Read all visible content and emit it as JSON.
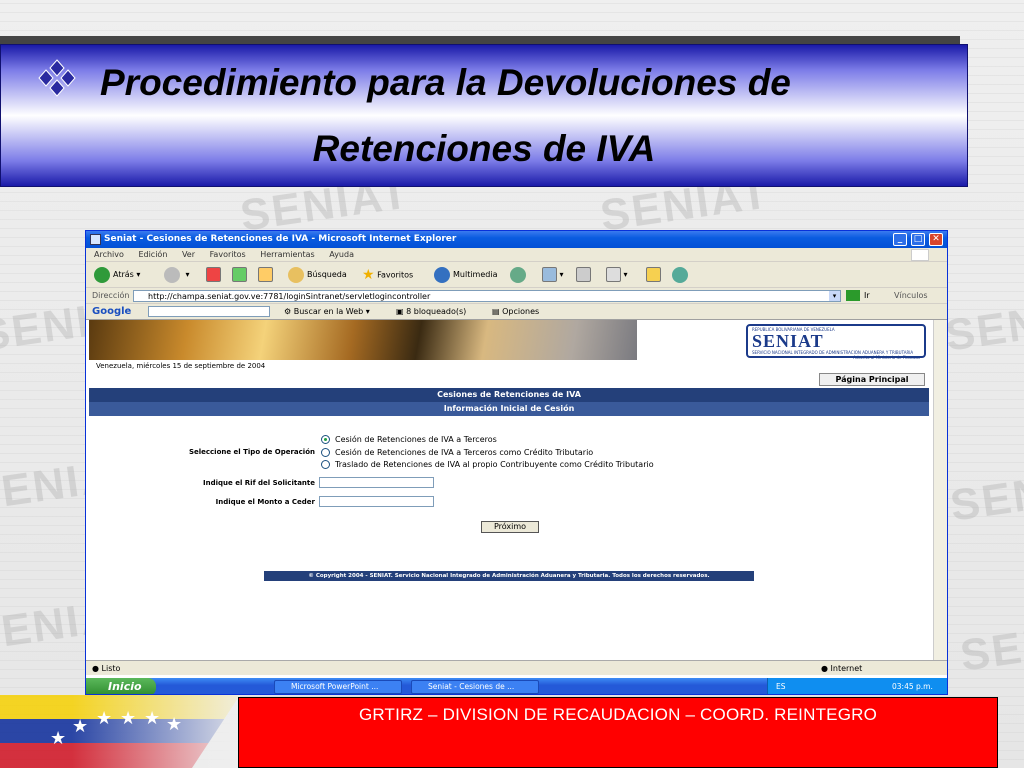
{
  "slide": {
    "title_line1": "Procedimiento para la Devoluciones de",
    "title_line2": "Retenciones de IVA",
    "footer": "GRTIRZ – DIVISION DE RECAUDACION – COORD. REINTEGRO",
    "watermark_text": "SENIAT",
    "colors": {
      "banner_dark": "#1a1aa8",
      "footer_bg": "#ff0000",
      "band_blue": "#24407a"
    }
  },
  "browser": {
    "window_title": "Seniat - Cesiones de Retenciones de IVA - Microsoft Internet Explorer",
    "menu": [
      "Archivo",
      "Edición",
      "Ver",
      "Favoritos",
      "Herramientas",
      "Ayuda"
    ],
    "toolbar": {
      "back": "Atrás",
      "search": "Búsqueda",
      "favorites": "Favoritos",
      "media": "Multimedia"
    },
    "address_label": "Dirección",
    "address_url": "http://champa.seniat.gov.ve:7781/loginSintranet/servletlogincontroller",
    "go_label": "Ir",
    "links_label": "Vínculos",
    "google": {
      "logo": "Google",
      "search_web": "Buscar en la Web",
      "blocked": "8 bloqueado(s)",
      "options": "Opciones"
    },
    "status": "Listo",
    "zone": "Internet"
  },
  "page": {
    "logo_top": "REPUBLICA BOLIVARIANA DE VENEZUELA",
    "logo_name": "SENIAT",
    "logo_sub1": "SERVICIO NACIONAL INTEGRADO DE ADMINISTRACION ADUANERA Y TRIBUTARIA",
    "logo_sub2": "Adscrito al Ministerio de Finanzas",
    "date": "Venezuela,  miércoles 15 de septiembre de 2004",
    "home_button": "Página Principal",
    "header1": "Cesiones de Retenciones de IVA",
    "header2": "Información Inicial de Cesión",
    "op_label": "Seleccione el Tipo de Operación",
    "options": [
      "Cesión de Retenciones de IVA a Terceros",
      "Cesión de Retenciones de IVA a Terceros como Crédito Tributario",
      "Traslado de Retenciones de IVA al propio Contribuyente como Crédito Tributario"
    ],
    "selected_option": 0,
    "rif_label": "Indique el Rif del Solicitante",
    "monto_label": "Indique el Monto a Ceder",
    "next_button": "Próximo",
    "copyright": "© Copyright 2004 - SENIAT. Servicio Nacional Integrado de Administración Aduanera y Tributaria. Todos los derechos reservados."
  },
  "taskbar": {
    "start": "Inicio",
    "tasks": [
      "Microsoft PowerPoint ...",
      "Seniat - Cesiones de ..."
    ],
    "lang": "ES",
    "clock": "03:45 p.m."
  }
}
